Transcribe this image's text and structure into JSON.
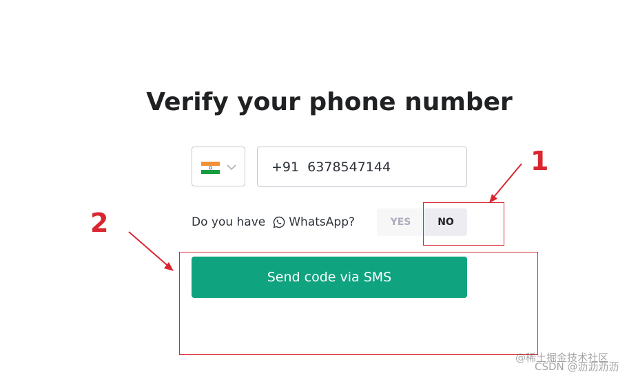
{
  "page": {
    "title": "Verify your phone number"
  },
  "phone": {
    "country_flag": "india-flag-icon",
    "number_value": "+91  6378547144"
  },
  "whatsapp": {
    "question_prefix": "Do you have",
    "question_app": "WhatsApp?",
    "yes_label": "YES",
    "no_label": "NO",
    "selected": "NO"
  },
  "actions": {
    "send_label": "Send code via SMS"
  },
  "annotations": {
    "marker_1": "1",
    "marker_2": "2"
  },
  "watermark": {
    "line1": "@稀土掘金技术社区",
    "line2": "CSDN @沥沥沥沥"
  },
  "colors": {
    "primary_button": "#10a37f",
    "annotation_red": "#d9262f"
  }
}
